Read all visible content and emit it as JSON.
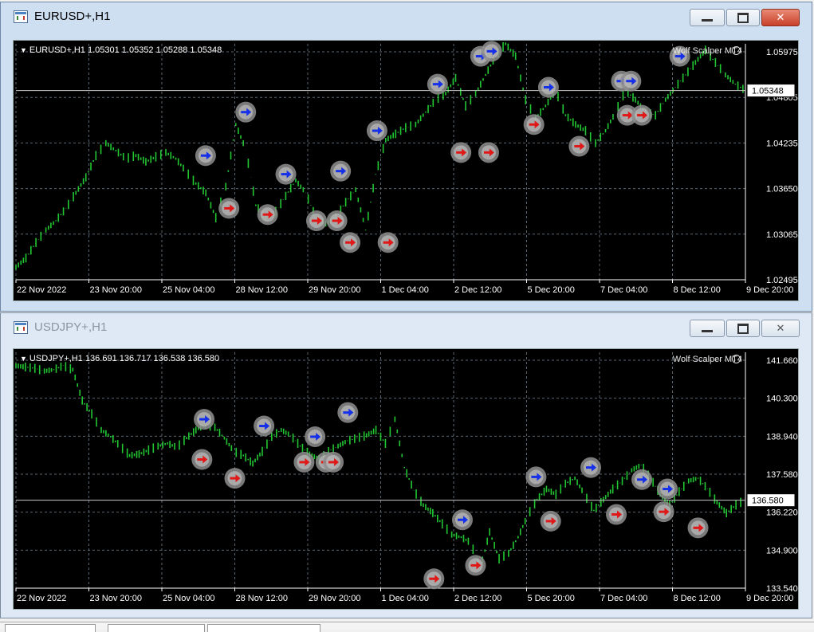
{
  "windows": [
    {
      "title": "EURUSD+,H1",
      "active": true,
      "ohlc_text": "EURUSD+,H1  1.05301 1.05352 1.05288 1.05348",
      "indicator": "Wolf Scalper MT4",
      "price_labels": [
        "1.05975",
        "1.05348",
        "1.04805",
        "1.04235",
        "1.03650",
        "1.03065",
        "1.02495"
      ],
      "current_price": "1.05348",
      "x_labels": [
        "22 Nov 2022",
        "23 Nov 20:00",
        "25 Nov 04:00",
        "28 Nov 12:00",
        "29 Nov 20:00",
        "1 Dec 04:00",
        "2 Dec 12:00",
        "5 Dec 20:00",
        "7 Dec 04:00",
        "8 Dec 12:00",
        "9 Dec 20:00"
      ],
      "price_line": [
        1.025,
        1.0265,
        1.029,
        1.031,
        1.0325,
        1.0345,
        1.037,
        1.0395,
        1.043,
        1.045,
        1.0438,
        1.0425,
        1.043,
        1.042,
        1.0428,
        1.0435,
        1.0425,
        1.0405,
        1.0385,
        1.037,
        1.033,
        1.038,
        1.048,
        1.044,
        1.035,
        1.033,
        1.034,
        1.0365,
        1.039,
        1.037,
        1.033,
        1.032,
        1.033,
        1.0355,
        1.0375,
        1.031,
        1.04,
        1.0455,
        1.0465,
        1.0475,
        1.048,
        1.05,
        1.052,
        1.053,
        1.0555,
        1.051,
        1.053,
        1.056,
        1.059,
        1.061,
        1.059,
        1.052,
        1.049,
        1.051,
        1.0535,
        1.0495,
        1.048,
        1.047,
        1.045,
        1.047,
        1.05,
        1.0535,
        1.052,
        1.05,
        1.0495,
        1.052,
        1.054,
        1.056,
        1.058,
        1.06,
        1.058,
        1.056,
        1.0545,
        1.0535
      ],
      "y_min": 1.023,
      "y_max": 1.061,
      "markers": [
        {
          "t": 0.26,
          "p": 1.043,
          "dir": "buy"
        },
        {
          "t": 0.292,
          "p": 1.0345,
          "dir": "sell"
        },
        {
          "t": 0.315,
          "p": 1.05,
          "dir": "buy"
        },
        {
          "t": 0.345,
          "p": 1.0335,
          "dir": "sell"
        },
        {
          "t": 0.37,
          "p": 1.04,
          "dir": "buy"
        },
        {
          "t": 0.412,
          "p": 1.0325,
          "dir": "sell"
        },
        {
          "t": 0.44,
          "p": 1.0325,
          "dir": "sell"
        },
        {
          "t": 0.445,
          "p": 1.0405,
          "dir": "buy"
        },
        {
          "t": 0.458,
          "p": 1.029,
          "dir": "sell"
        },
        {
          "t": 0.495,
          "p": 1.047,
          "dir": "buy"
        },
        {
          "t": 0.51,
          "p": 1.029,
          "dir": "sell"
        },
        {
          "t": 0.578,
          "p": 1.0545,
          "dir": "buy"
        },
        {
          "t": 0.61,
          "p": 1.0435,
          "dir": "sell"
        },
        {
          "t": 0.637,
          "p": 1.059,
          "dir": "buy"
        },
        {
          "t": 0.648,
          "p": 1.0435,
          "dir": "sell"
        },
        {
          "t": 0.652,
          "p": 1.0598,
          "dir": "buy"
        },
        {
          "t": 0.71,
          "p": 1.048,
          "dir": "sell"
        },
        {
          "t": 0.73,
          "p": 1.054,
          "dir": "buy"
        },
        {
          "t": 0.772,
          "p": 1.0445,
          "dir": "sell"
        },
        {
          "t": 0.83,
          "p": 1.055,
          "dir": "buy"
        },
        {
          "t": 0.843,
          "p": 1.055,
          "dir": "buy"
        },
        {
          "t": 0.838,
          "p": 1.0495,
          "dir": "sell"
        },
        {
          "t": 0.858,
          "p": 1.0495,
          "dir": "sell"
        },
        {
          "t": 0.91,
          "p": 1.059,
          "dir": "buy"
        }
      ]
    },
    {
      "title": "USDJPY+,H1",
      "active": false,
      "ohlc_text": "USDJPY+,H1  136.691 136.717 136.538 136.580",
      "indicator": "Wolf Scalper MT4",
      "price_labels": [
        "141.660",
        "140.300",
        "138.940",
        "137.580",
        "136.580",
        "136.220",
        "134.900",
        "133.540"
      ],
      "current_price": "136.580",
      "x_labels": [
        "22 Nov 2022",
        "23 Nov 20:00",
        "25 Nov 04:00",
        "28 Nov 12:00",
        "29 Nov 20:00",
        "1 Dec 04:00",
        "2 Dec 12:00",
        "5 Dec 20:00",
        "7 Dec 04:00",
        "8 Dec 12:00",
        "9 Dec 20:00"
      ],
      "price_line": [
        141.6,
        141.55,
        141.5,
        141.4,
        141.45,
        141.6,
        141.45,
        140.3,
        139.8,
        139.2,
        138.95,
        138.6,
        138.25,
        138.3,
        138.45,
        138.6,
        138.7,
        138.55,
        138.9,
        139.2,
        139.4,
        139.3,
        138.9,
        138.4,
        138.25,
        137.95,
        138.4,
        138.95,
        139.2,
        139.0,
        138.6,
        138.3,
        138.1,
        138.4,
        138.6,
        138.8,
        138.9,
        139.0,
        139.2,
        138.7,
        139.6,
        137.8,
        136.95,
        136.4,
        136.1,
        135.7,
        135.3,
        135.2,
        135.0,
        134.0,
        135.4,
        134.4,
        134.6,
        135.2,
        136.0,
        136.6,
        137.0,
        136.8,
        137.2,
        137.4,
        136.8,
        136.2,
        136.6,
        137.0,
        137.3,
        137.7,
        137.9,
        137.4,
        136.8,
        136.4,
        136.9,
        137.3,
        137.4,
        137.0,
        136.5,
        136.1,
        136.4,
        136.6
      ],
      "y_min": 133.3,
      "y_max": 142.1,
      "markers": [
        {
          "t": 0.258,
          "p": 139.6,
          "dir": "buy"
        },
        {
          "t": 0.255,
          "p": 138.1,
          "dir": "sell"
        },
        {
          "t": 0.3,
          "p": 137.4,
          "dir": "sell"
        },
        {
          "t": 0.34,
          "p": 139.35,
          "dir": "buy"
        },
        {
          "t": 0.395,
          "p": 138.0,
          "dir": "sell"
        },
        {
          "t": 0.41,
          "p": 138.95,
          "dir": "buy"
        },
        {
          "t": 0.425,
          "p": 138.0,
          "dir": "sell"
        },
        {
          "t": 0.435,
          "p": 138.0,
          "dir": "sell"
        },
        {
          "t": 0.455,
          "p": 139.85,
          "dir": "buy"
        },
        {
          "t": 0.573,
          "p": 133.65,
          "dir": "sell"
        },
        {
          "t": 0.612,
          "p": 135.85,
          "dir": "buy"
        },
        {
          "t": 0.63,
          "p": 134.15,
          "dir": "sell"
        },
        {
          "t": 0.713,
          "p": 137.45,
          "dir": "buy"
        },
        {
          "t": 0.733,
          "p": 135.8,
          "dir": "sell"
        },
        {
          "t": 0.788,
          "p": 137.8,
          "dir": "buy"
        },
        {
          "t": 0.823,
          "p": 136.05,
          "dir": "sell"
        },
        {
          "t": 0.858,
          "p": 137.35,
          "dir": "buy"
        },
        {
          "t": 0.888,
          "p": 136.15,
          "dir": "sell"
        },
        {
          "t": 0.893,
          "p": 137.0,
          "dir": "buy"
        },
        {
          "t": 0.935,
          "p": 135.55,
          "dir": "sell"
        }
      ]
    }
  ]
}
